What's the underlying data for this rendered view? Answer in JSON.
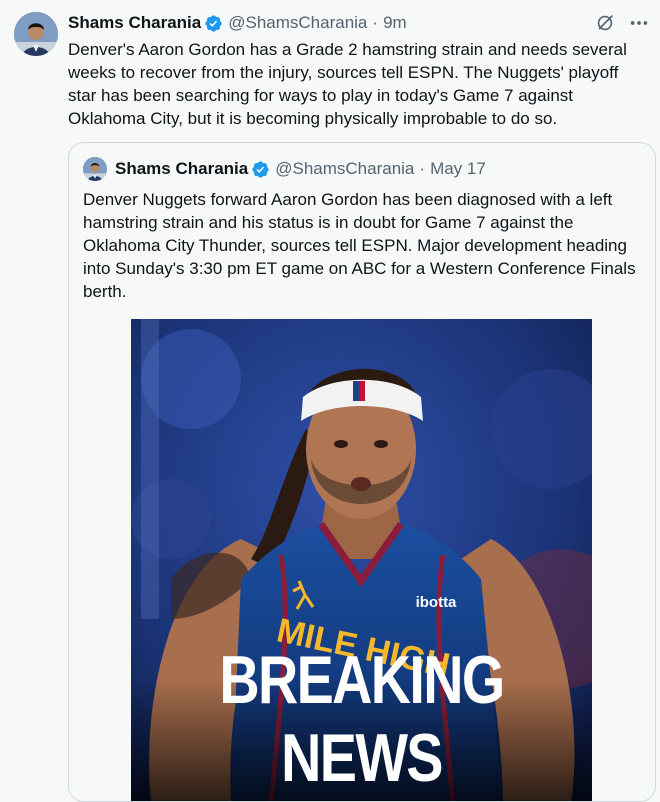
{
  "tweet": {
    "author_name": "Shams Charania",
    "handle": "@ShamsCharania",
    "separator": "·",
    "time": "9m",
    "text": "Denver's Aaron Gordon has a Grade 2 hamstring strain and needs several weeks to recover from the injury, sources tell ESPN. The Nuggets' playoff star has been searching for ways to play in today's Game 7 against Oklahoma City, but it is becoming physically improbable to do so."
  },
  "quoted_tweet": {
    "author_name": "Shams Charania",
    "handle": "@ShamsCharania",
    "separator": "·",
    "time": "May 17",
    "text": "Denver Nuggets forward Aaron Gordon has been diagnosed with a left hamstring strain and his status is in doubt for Game 7 against the Oklahoma City Thunder, sources tell ESPN. Major development heading into Sunday's 3:30 pm ET game on ABC for a Western Conference Finals berth.",
    "image": {
      "overlay_text": "BREAKING NEWS",
      "jersey_text": "MILE HIGH",
      "sponsor_text": "ibotta"
    }
  },
  "icons": {
    "verified": "verified-badge-icon",
    "grok": "grok-icon",
    "more": "more-options-icon"
  },
  "colors": {
    "verified": "#1d9bf0",
    "secondary_text": "#536471",
    "primary_text": "#0f1419",
    "background": "#f7f9f9",
    "border": "#cfd9de"
  }
}
